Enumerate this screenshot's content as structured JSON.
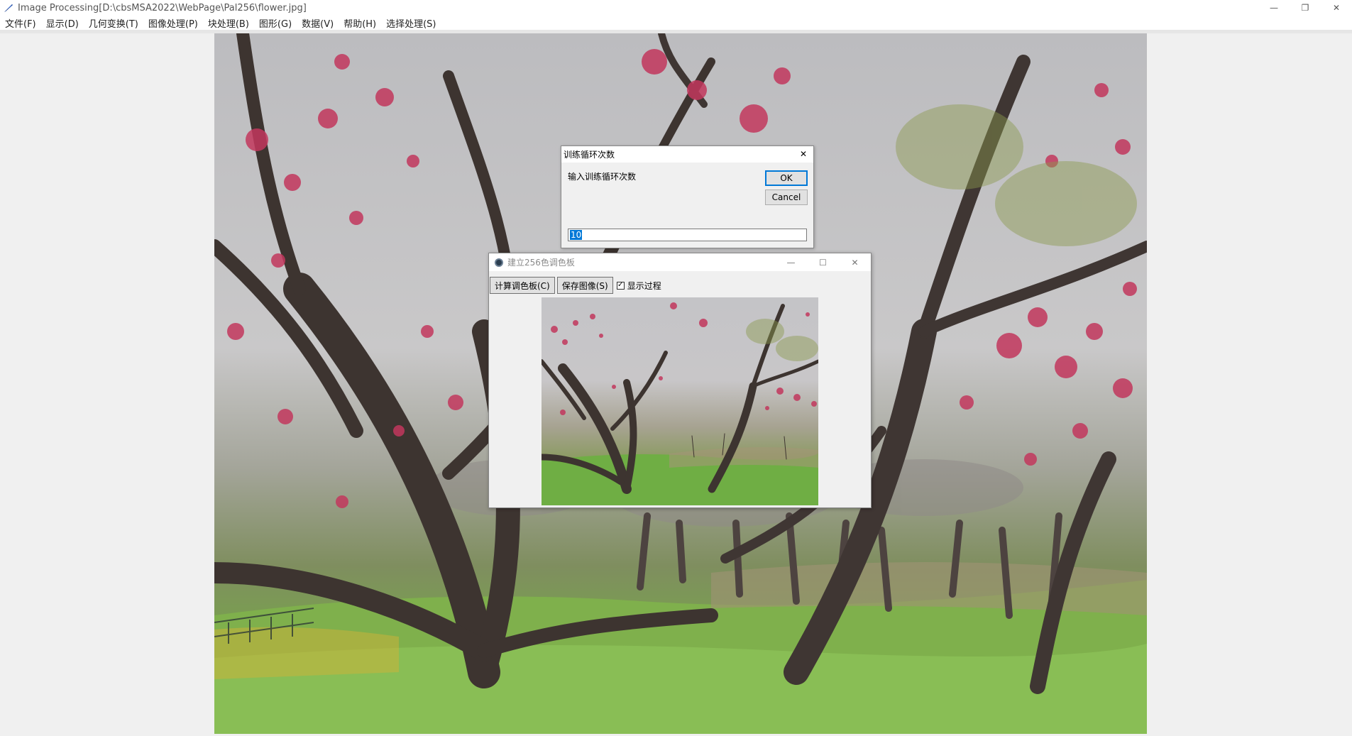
{
  "window": {
    "title": "Image Processing[D:\\cbsMSA2022\\WebPage\\Pal256\\flower.jpg]",
    "icon": "feather-pen-icon",
    "controls": {
      "minimize": "—",
      "restore": "❐",
      "close": "✕"
    }
  },
  "menu": {
    "items": [
      "文件(F)",
      "显示(D)",
      "几何变换(T)",
      "图像处理(P)",
      "块处理(B)",
      "图形(G)",
      "数据(V)",
      "帮助(H)",
      "选择处理(S)"
    ]
  },
  "loops_dialog": {
    "title": "训练循环次数",
    "prompt": "输入训练循环次数",
    "ok_label": "OK",
    "cancel_label": "Cancel",
    "close_glyph": "✕",
    "input_value": "10"
  },
  "palette_dialog": {
    "title": "建立256色调色板",
    "controls": {
      "minimize": "—",
      "maximize": "☐",
      "close": "✕"
    },
    "compute_label": "计算调色板(C)",
    "save_label": "保存图像(S)",
    "show_process_label": "显示过程",
    "show_process_checked": true,
    "check_glyph": "✓"
  },
  "colors": {
    "accent": "#0078d7",
    "blossom": "#c2375d",
    "bark": "#3d3430",
    "grass": "#7fb04c"
  }
}
